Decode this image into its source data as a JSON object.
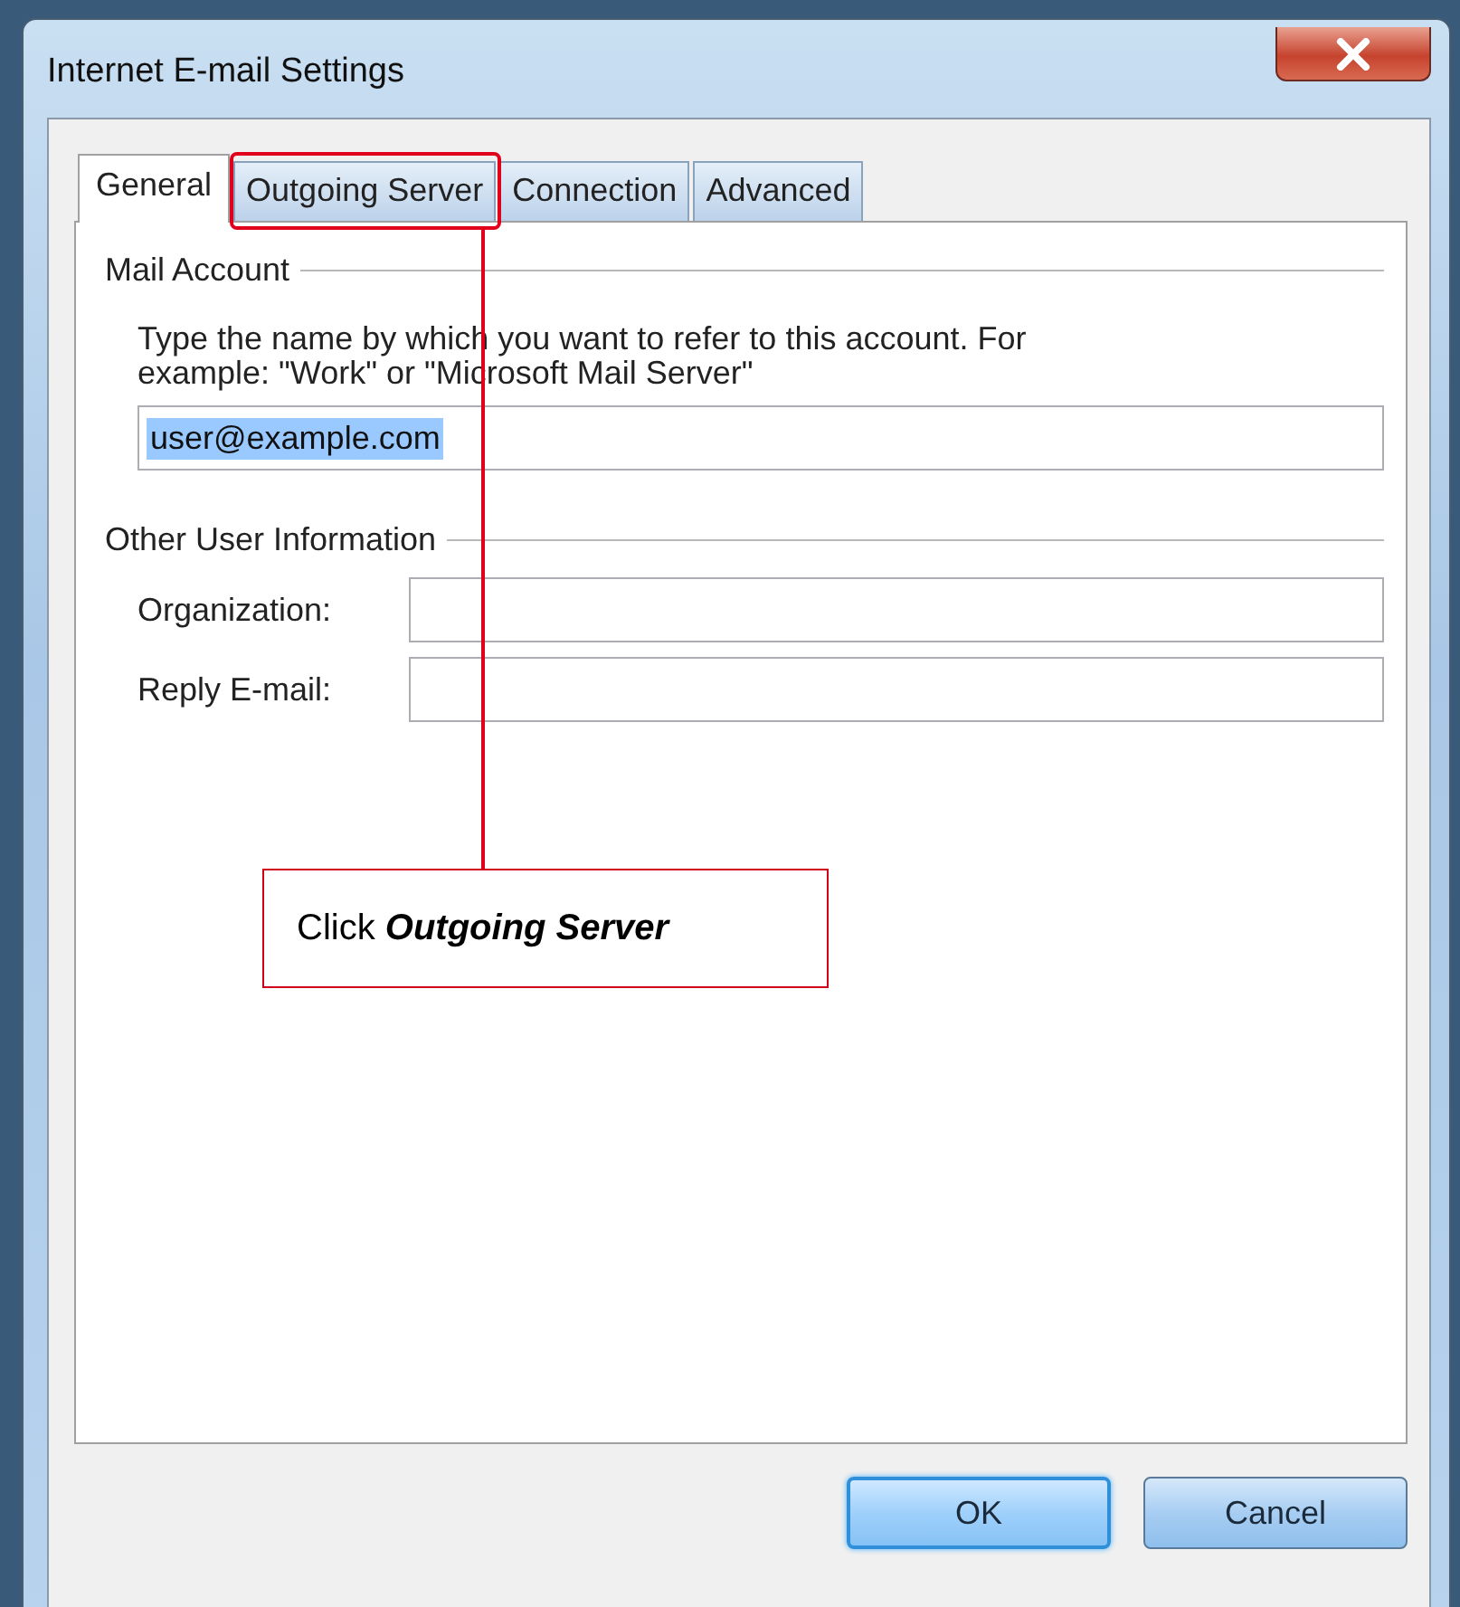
{
  "window": {
    "title": "Internet E-mail Settings"
  },
  "tabs": [
    {
      "label": "General",
      "selected": true
    },
    {
      "label": "Outgoing Server",
      "selected": false
    },
    {
      "label": "Connection",
      "selected": false
    },
    {
      "label": "Advanced",
      "selected": false
    }
  ],
  "mail_account": {
    "heading": "Mail Account",
    "description": "Type the name by which you want to refer to this account. For example: \"Work\" or \"Microsoft Mail Server\"",
    "name_field": {
      "value": "user@example.com",
      "highlighted": true
    }
  },
  "other_user_information": {
    "heading": "Other User Information",
    "fields": [
      {
        "label": "Organization:"
      },
      {
        "label": "Reply E-mail:"
      }
    ]
  },
  "buttons": [
    {
      "label": "OK",
      "default": true
    },
    {
      "label": "Cancel",
      "default": false
    }
  ],
  "callout": {
    "text": "Click **Outgoing Server**"
  }
}
